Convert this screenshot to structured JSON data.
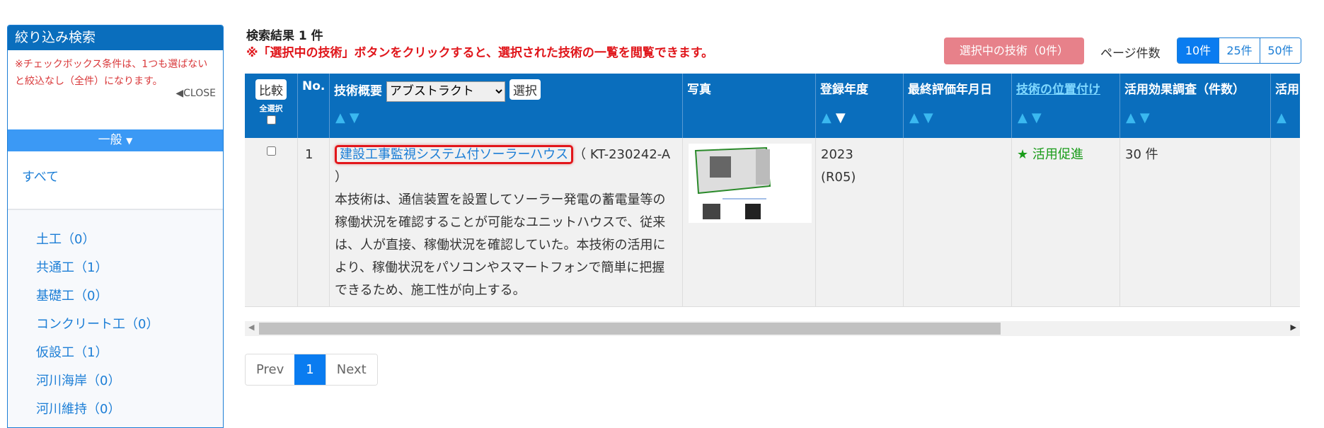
{
  "sidebar": {
    "title": "絞り込み検索",
    "notice": "※チェックボックス条件は、1つも選ばないと絞込なし（全件）になります。",
    "close": "◀CLOSE",
    "section": "一般",
    "all": "すべて",
    "items": [
      "土工（0）",
      "共通工（1）",
      "基礎工（0）",
      "コンクリート工（0）",
      "仮設工（1）",
      "河川海岸（0）",
      "河川維持（0）"
    ]
  },
  "results": {
    "title": "検索結果 1 件",
    "notice": "※「選択中の技術」ボタンをクリックすると、選択された技術の一覧を閲覧できます。",
    "selected_button": "選択中の技術（0件）",
    "page_count_label": "ページ件数",
    "page_counts": [
      "10件",
      "25件",
      "50件"
    ],
    "page_count_selected": "10件"
  },
  "table": {
    "headers": {
      "compare": "比較",
      "select_all": "全選択",
      "no": "No.",
      "summary": "技術概要",
      "summary_select": "アブストラクト",
      "select_button": "選択",
      "photo": "写真",
      "year": "登録年度",
      "last_eval": "最終評価年月日",
      "position": "技術の位置付け",
      "survey": "活用効果調査（件数）",
      "more": "活用"
    },
    "rows": [
      {
        "no": "1",
        "title": "建設工事監視システム付ソーラーハウス",
        "code": "（ KT-230242-A ）",
        "description": "本技術は、通信装置を設置してソーラー発電の蓄電量等の稼働状況を確認することが可能なユニットハウスで、従来は、人が直接、稼働状況を確認していた。本技術の活用により、稼働状況をパソコンやスマートフォンで簡単に把握できるため、施工性が向上する。",
        "year": "2023",
        "era": "(R05)",
        "last_eval": "",
        "position": "★ 活用促進",
        "survey": "30 件"
      }
    ]
  },
  "pagination": {
    "prev": "Prev",
    "current": "1",
    "next": "Next"
  },
  "colors": {
    "header": "#0a6ebd",
    "accent": "#0a7cf0",
    "notice": "#e0161b",
    "promote": "#1a9c1a"
  }
}
